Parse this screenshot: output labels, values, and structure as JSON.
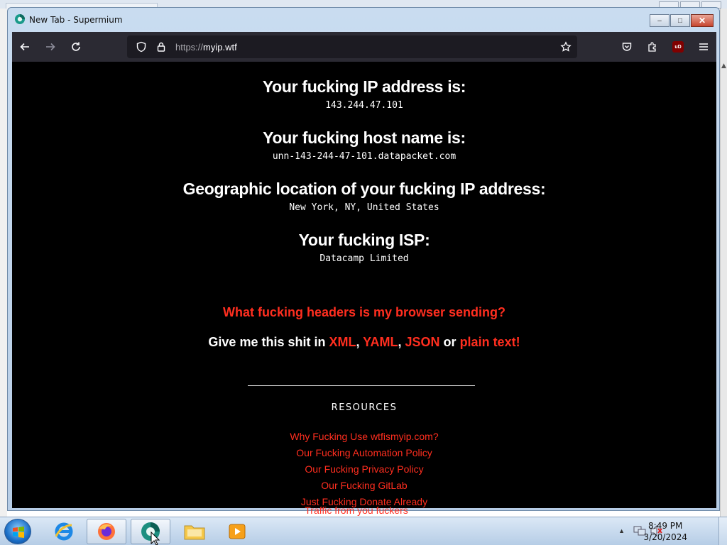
{
  "window": {
    "title": "New Tab - Supermium",
    "controls": {
      "minimize": "–",
      "maximize": "□",
      "close": "✕"
    }
  },
  "toolbar": {
    "back_icon": "back-arrow-icon",
    "forward_icon": "forward-arrow-icon",
    "reload_icon": "reload-icon",
    "url_scheme": "https://",
    "url_host": "myip.wtf",
    "bookmark_icon": "star-icon",
    "right_icons": [
      "pocket-icon",
      "extensions-icon",
      "ublock-icon",
      "menu-icon"
    ],
    "ublock_label": "uD"
  },
  "page": {
    "ip_heading": "Your fucking IP address is:",
    "ip_value": "143.244.47.101",
    "host_heading": "Your fucking host name is:",
    "host_value": "unn-143-244-47-101.datapacket.com",
    "geo_heading": "Geographic location of your fucking IP address:",
    "geo_value": "New York, NY, United States",
    "isp_heading": "Your fucking ISP:",
    "isp_value": "Datacamp Limited",
    "headers_link": "What fucking headers is my browser sending?",
    "formats_prefix": "Give me this shit in ",
    "formats": {
      "xml": "XML",
      "yaml": "YAML",
      "json": "JSON",
      "plain": "plain text!",
      "sep1": ", ",
      "sep2": ", ",
      "or": " or "
    },
    "resources_heading": "RESOURCES",
    "resources_links": [
      "Why Fucking Use wtfismyip.com?",
      "Our Fucking Automation Policy",
      "Our Fucking Privacy Policy",
      "Our Fucking GitLab",
      "Just Fucking Donate Already",
      "Traffic from you fuckers"
    ]
  },
  "colors": {
    "page_bg": "#000000",
    "link_red": "#ff2e1f",
    "toolbar_bg": "#2b2a33"
  },
  "taskbar": {
    "apps": [
      "start-orb",
      "internet-explorer-icon",
      "firefox-icon",
      "supermium-icon",
      "file-explorer-icon",
      "media-player-icon"
    ],
    "time": "8:49 PM",
    "date": "3/20/2024"
  }
}
